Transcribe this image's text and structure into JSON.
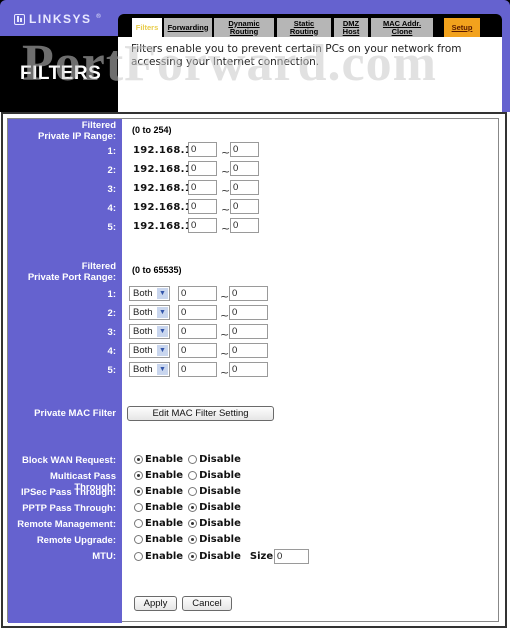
{
  "brand": {
    "logo_text": "LINKSYS",
    "logo_mark": "®"
  },
  "header": {
    "page_title": "FILTERS",
    "description": "Filters enable you to prevent certain PCs on your network from accessing your Internet connection.",
    "watermark": "PortForward.com"
  },
  "tabs": [
    {
      "label": "Filters",
      "active": true
    },
    {
      "label": "Forwarding"
    },
    {
      "label": "Dynamic Routing"
    },
    {
      "label": "Static Routing"
    },
    {
      "label": "DMZ Host"
    },
    {
      "label": "MAC Addr. Clone"
    },
    {
      "label": "Setup"
    }
  ],
  "ip_range": {
    "label_line1": "Filtered",
    "label_line2": "Private IP Range:",
    "hint": "(0 to 254)",
    "prefix": "192.168.1.",
    "rows": [
      {
        "label": "1:",
        "start": "0",
        "end": "0"
      },
      {
        "label": "2:",
        "start": "0",
        "end": "0"
      },
      {
        "label": "3:",
        "start": "0",
        "end": "0"
      },
      {
        "label": "4:",
        "start": "0",
        "end": "0"
      },
      {
        "label": "5:",
        "start": "0",
        "end": "0"
      }
    ]
  },
  "port_range": {
    "label_line1": "Filtered",
    "label_line2": "Private Port Range:",
    "hint": "(0 to 65535)",
    "rows": [
      {
        "label": "1:",
        "protocol": "Both",
        "start": "0",
        "end": "0"
      },
      {
        "label": "2:",
        "protocol": "Both",
        "start": "0",
        "end": "0"
      },
      {
        "label": "3:",
        "protocol": "Both",
        "start": "0",
        "end": "0"
      },
      {
        "label": "4:",
        "protocol": "Both",
        "start": "0",
        "end": "0"
      },
      {
        "label": "5:",
        "protocol": "Both",
        "start": "0",
        "end": "0"
      }
    ]
  },
  "mac_filter": {
    "label": "Private MAC Filter",
    "button": "Edit MAC Filter Setting"
  },
  "options": {
    "enable_label": "Enable",
    "disable_label": "Disable",
    "rows": [
      {
        "label": "Block WAN Request:",
        "value": "Enable"
      },
      {
        "label": "Multicast Pass Through:",
        "value": "Enable"
      },
      {
        "label": "IPSec Pass Through:",
        "value": "Enable"
      },
      {
        "label": "PPTP Pass Through:",
        "value": "Disable"
      },
      {
        "label": "Remote Management:",
        "value": "Disable"
      },
      {
        "label": "Remote Upgrade:",
        "value": "Disable"
      },
      {
        "label": "MTU:",
        "value": "Disable"
      }
    ],
    "mtu_size_label": "Size:",
    "mtu_size_value": "0"
  },
  "actions": {
    "apply": "Apply",
    "cancel": "Cancel"
  },
  "colors": {
    "sidebar": "#6562cf",
    "setup_tab": "#f2a21d",
    "active_tab_text": "#e8cc4a"
  }
}
